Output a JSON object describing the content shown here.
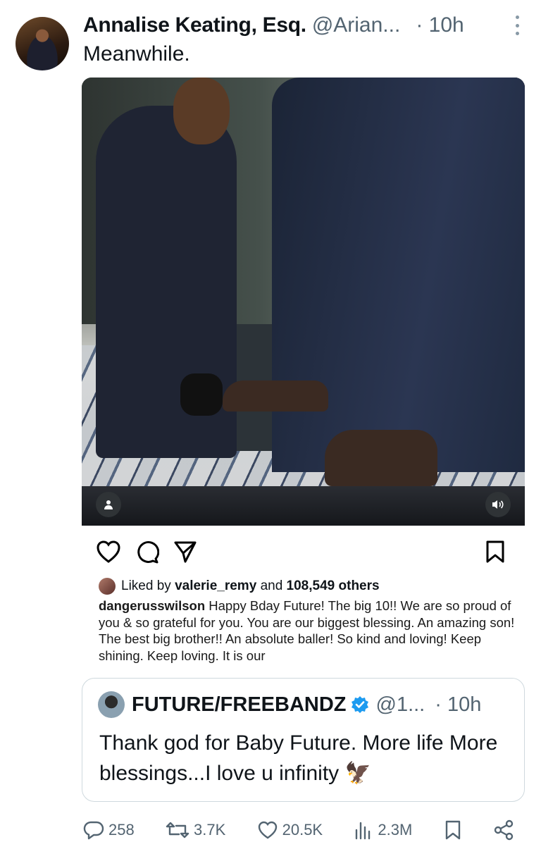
{
  "tweet": {
    "author_name": "Annalise Keating, Esq.",
    "author_handle": "@Arian...",
    "time": "· 10h",
    "text": "Meanwhile."
  },
  "instagram": {
    "liked_by_prefix": "Liked by",
    "liked_by_user": "valerie_remy",
    "liked_by_middle": "and",
    "liked_by_count": "108,549 others",
    "caption_user": "dangerusswilson",
    "caption_text": "Happy Bday Future! The big 10!! We are so proud of you & so grateful for you. You are our biggest blessing. An amazing son! The best big brother!! An absolute baller! So kind and loving! Keep shining. Keep loving. It is our"
  },
  "quote": {
    "author_name": "FUTURE/FREEBANDZ",
    "author_handle": "@1...",
    "time": "· 10h",
    "text": "Thank god for Baby Future. More life More blessings...I love u infinity 🦅"
  },
  "stats": {
    "replies": "258",
    "reposts": "3.7K",
    "likes": "20.5K",
    "views": "2.3M"
  },
  "colors": {
    "verified": "#1d9bf0",
    "muted_text": "#536471",
    "border": "#cfd9de"
  }
}
